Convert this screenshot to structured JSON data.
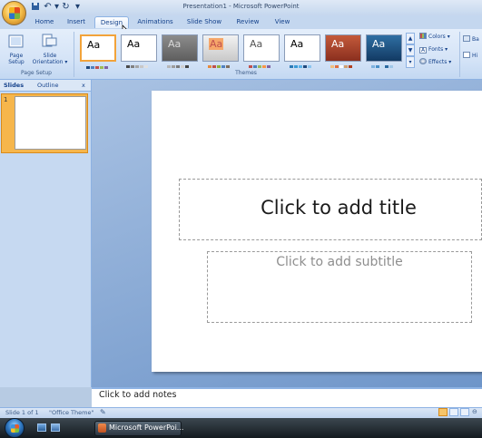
{
  "window": {
    "title": "Presentation1 - Microsoft PowerPoint"
  },
  "quick_access": {
    "save_icon": "save-icon",
    "undo_icon": "undo-icon",
    "redo_icon": "redo-icon"
  },
  "tabs": [
    {
      "label": "Home"
    },
    {
      "label": "Insert"
    },
    {
      "label": "Design",
      "selected": true
    },
    {
      "label": "Animations"
    },
    {
      "label": "Slide Show"
    },
    {
      "label": "Review"
    },
    {
      "label": "View"
    }
  ],
  "ribbon": {
    "page_setup_group": {
      "label": "Page Setup",
      "page_setup_label_1": "Page",
      "page_setup_label_2": "Setup",
      "orientation_label_1": "Slide",
      "orientation_label_2": "Orientation ▾"
    },
    "themes_group": {
      "label": "Themes",
      "theme_thumbnail_text": "Aa",
      "theme_count": 8
    },
    "theme_options": {
      "colors": "Colors ▾",
      "fonts": "Fonts ▾",
      "effects": "Effects ▾"
    },
    "background_partial": {
      "line1": "Ba",
      "line2": "Hi"
    }
  },
  "left_pane": {
    "tab_slides": "Slides",
    "tab_outline": "Outline",
    "close": "x",
    "thumbnail_number": "1"
  },
  "slide": {
    "title_placeholder": "Click to add title",
    "subtitle_placeholder": "Click to add subtitle"
  },
  "notes": {
    "placeholder": "Click to add notes"
  },
  "status_bar": {
    "slide_info": "Slide 1 of 1",
    "theme_name": "\"Office Theme\""
  },
  "taskbar": {
    "app_button": "Microsoft PowerPoi..."
  },
  "colors": {
    "ribbon": "#d5e4f7",
    "accent": "#f6b64c",
    "editing_bg": "#6e95c9"
  }
}
